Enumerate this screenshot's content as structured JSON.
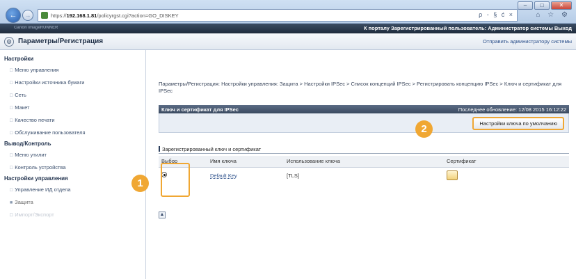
{
  "browser": {
    "url_prefix": "https://",
    "url_host": "192.168.1.81",
    "url_path": "/policyrgst.cgi?action=GO_DISKEY",
    "addr_tools": "ρ - § ć ×",
    "tab_tools": "⌂ ☆ ⚙",
    "win_controls": [
      "–",
      "□",
      "✕"
    ]
  },
  "portalbar": {
    "left_label": "Canon imageRUNNER",
    "right_text": "К порталу  Зарегистрированный пользователь: Администратор системы Выход"
  },
  "header": {
    "title": "Параметры/Регистрация",
    "mail_link": "Отправить администратору системы"
  },
  "sidebar": {
    "groups": [
      {
        "label": "Настройки",
        "items": [
          {
            "label": "Меню управления"
          },
          {
            "label": "Настройки источника бумаги"
          },
          {
            "label": "Сеть"
          },
          {
            "label": "Макет"
          },
          {
            "label": "Качество печати"
          },
          {
            "label": "Обслуживание пользователя"
          }
        ]
      },
      {
        "label": "Вывод/Контроль",
        "items": [
          {
            "label": "Меню утилит"
          },
          {
            "label": "Контроль устройства"
          }
        ]
      },
      {
        "label": "Настройки управления",
        "items": [
          {
            "label": "Управление ИД отдела"
          },
          {
            "label": "Защита"
          },
          {
            "label": "Импорт/Экспорт"
          }
        ]
      }
    ]
  },
  "main": {
    "breadcrumb": "Параметры/Регистрация: Настройки управления: Защита > Настройки IPSec > Список концепций IPSec > Регистрировать концепцию IPSec > Ключ и сертификат для IPSec",
    "panel_title": "Ключ и сертификат для IPSec",
    "last_updated": "Последнее обновление: 12/08 2015 16:12:22",
    "default_key_button": "Настройки ключа по умолчанию",
    "section_title": "Зарегистрированный ключ и сертификат",
    "table": {
      "headers": [
        "Выбор",
        "Имя ключа",
        "Использование ключа",
        "Сертификат"
      ],
      "rows": [
        {
          "selected": true,
          "name": "Default Key",
          "usage": "[TLS]",
          "certificate_icon": "certificate-icon"
        }
      ]
    },
    "back_to_top": "▲"
  },
  "callouts": [
    "1",
    "2"
  ],
  "colors": {
    "accent": "#f0a733",
    "header_dark": "#2a384b",
    "link": "#2b4f8a"
  }
}
